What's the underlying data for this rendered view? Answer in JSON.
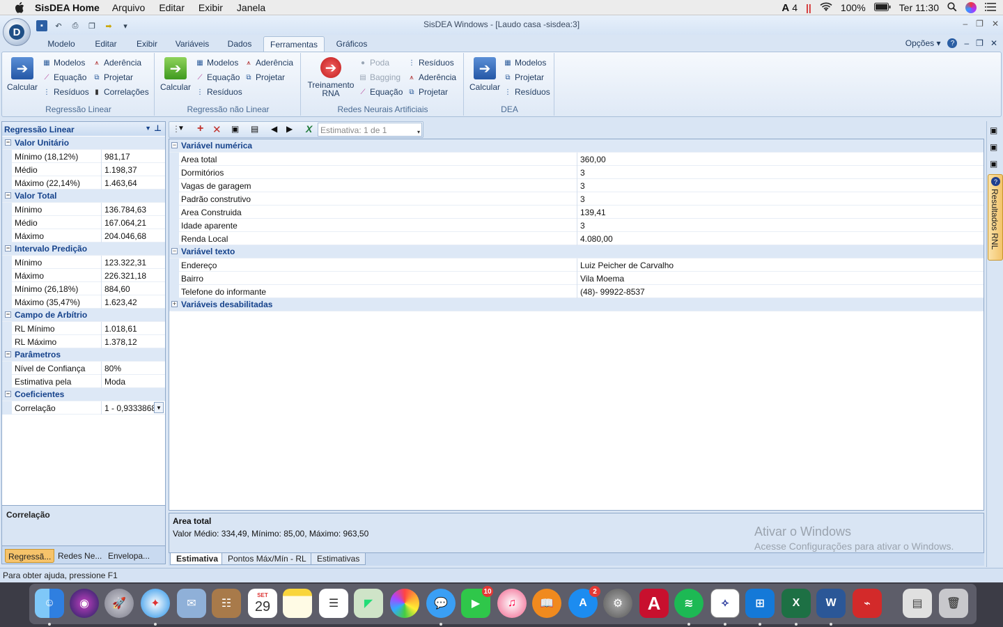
{
  "macbar": {
    "app_name": "SisDEA Home",
    "menus": [
      "Arquivo",
      "Editar",
      "Exibir",
      "Janela"
    ],
    "status": {
      "adobe_count": "4",
      "battery": "100%",
      "clock": "Ter 11:30"
    }
  },
  "window": {
    "title": "SisDEA Windows - [Laudo casa -sisdea:3]",
    "orb_letter": "D"
  },
  "ribbon": {
    "tabs": [
      "Modelo",
      "Editar",
      "Exibir",
      "Variáveis",
      "Dados",
      "Ferramentas",
      "Gráficos"
    ],
    "active_tab": "Ferramentas",
    "options_label": "Opções",
    "groups": {
      "regressao_linear": {
        "title": "Regressão Linear",
        "calc": "Calcular",
        "items": [
          "Modelos",
          "Aderência",
          "Equação",
          "Projetar",
          "Resíduos",
          "Correlações"
        ]
      },
      "regressao_nao_linear": {
        "title": "Regressão não Linear",
        "calc": "Calcular",
        "items": [
          "Modelos",
          "Aderência",
          "Equação",
          "Projetar",
          "Resíduos"
        ]
      },
      "rna": {
        "title": "Redes Neurais Artificiais",
        "train_line1": "Treinamento",
        "train_line2": "RNA",
        "items": [
          "Poda",
          "Resíduos",
          "Bagging",
          "Aderência",
          "Equação",
          "Projetar"
        ]
      },
      "dea": {
        "title": "DEA",
        "calc": "Calcular",
        "items": [
          "Modelos",
          "Projetar",
          "Resíduos"
        ]
      }
    }
  },
  "left_panel": {
    "title": "Regressão Linear",
    "sections": [
      {
        "name": "Valor Unitário",
        "rows": [
          [
            "Mínimo (18,12%)",
            "981,17"
          ],
          [
            "Médio",
            "1.198,37"
          ],
          [
            "Máximo (22,14%)",
            "1.463,64"
          ]
        ]
      },
      {
        "name": "Valor Total",
        "rows": [
          [
            "Mínimo",
            "136.784,63"
          ],
          [
            "Médio",
            "167.064,21"
          ],
          [
            "Máximo",
            "204.046,68"
          ]
        ]
      },
      {
        "name": "Intervalo Predição",
        "rows": [
          [
            "Mínimo",
            "123.322,31"
          ],
          [
            "Máximo",
            "226.321,18"
          ],
          [
            "Mínimo (26,18%)",
            "884,60"
          ],
          [
            "Máximo (35,47%)",
            "1.623,42"
          ]
        ]
      },
      {
        "name": "Campo de Arbítrio",
        "rows": [
          [
            "RL Mínimo",
            "1.018,61"
          ],
          [
            "RL Máximo",
            "1.378,12"
          ]
        ]
      },
      {
        "name": "Parâmetros",
        "rows": [
          [
            "Nível de Confiança",
            "80%"
          ],
          [
            "Estimativa pela",
            "Moda"
          ]
        ]
      },
      {
        "name": "Coeficientes",
        "rows": [
          [
            "Correlação",
            "1 - 0,9333868"
          ]
        ]
      }
    ],
    "description_title": "Correlação",
    "bottom_tabs": [
      "Regressã...",
      "Redes Ne...",
      "Envelopa..."
    ]
  },
  "main": {
    "toolbar": {
      "estimate_label": "Estimativa: 1 de 1"
    },
    "grid": {
      "numeric_title": "Variável numérica",
      "numeric_rows": [
        [
          "Area total",
          "360,00"
        ],
        [
          "Dormitórios",
          "3"
        ],
        [
          "Vagas de garagem",
          "3"
        ],
        [
          "Padrão construtivo",
          "3"
        ],
        [
          "Area Construida",
          "139,41"
        ],
        [
          "Idade aparente",
          "3"
        ],
        [
          "Renda Local",
          "4.080,00"
        ]
      ],
      "text_title": "Variável texto",
      "text_rows": [
        [
          "Endereço",
          "Luiz Peicher de Carvalho"
        ],
        [
          "Bairro",
          "Vila Moema"
        ],
        [
          "Telefone do informante",
          "(48)- 99922-8537"
        ]
      ],
      "disabled_title": "Variáveis desabilitadas"
    },
    "info": {
      "title": "Area total",
      "detail": "Valor Médio: 334,49, Mínimo: 85,00, Máximo: 963,50"
    },
    "watermark": {
      "line1": "Ativar o Windows",
      "line2": "Acesse Configurações para ativar o Windows."
    },
    "bottom_tabs": [
      "Estimativa",
      "Pontos Máx/Mín - RL",
      "Estimativas"
    ]
  },
  "right_panel": {
    "tab_label": "Resultados RNL"
  },
  "statusbar": {
    "text": "Para obter ajuda, pressione F1"
  },
  "dock": {
    "calendar_month": "SET",
    "calendar_day": "29",
    "facetime_badge": "10",
    "appstore_badge": "2"
  }
}
